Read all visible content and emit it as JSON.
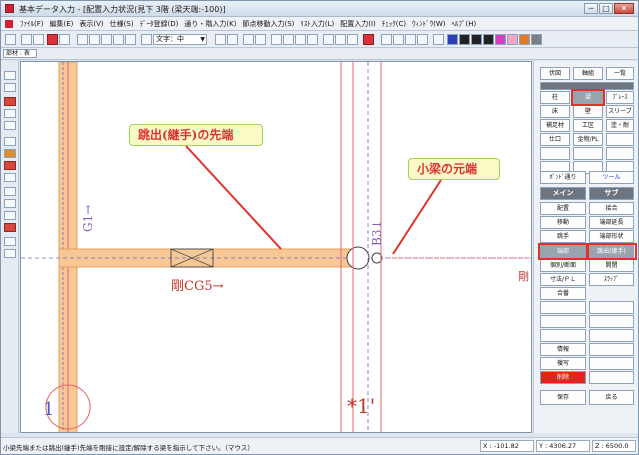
{
  "window": {
    "title": "基本データ入力 - [配置入力状況(見下 3階 (梁天端:-100)]",
    "controls": [
      "─",
      "□",
      "✕"
    ]
  },
  "menu": [
    "ﾌｧｲﾙ(F)",
    "編集(E)",
    "表示(V)",
    "仕様(S)",
    "ﾃﾞｰﾀ登録(D)",
    "通り・階入力(K)",
    "節点移動入力(S)",
    "ﾘｽﾄ入力(L)",
    "配置入力(I)",
    "ﾁｪｯｸ(C)",
    "ｳｨﾝﾄﾞｳ(W)",
    "ﾍﾙﾌﾟ(H)"
  ],
  "toolbar": {
    "font_combo": "文字：中",
    "colors": [
      "#2a3fb8",
      "#222222",
      "#222222",
      "#222222",
      "#d040c0",
      "#f2a6c8",
      "#e07b2a",
      "#7b7f86"
    ]
  },
  "subbar": {
    "field": "部材 : 表"
  },
  "canvas": {
    "callout_tip": "跳出(継手)の先端",
    "callout_base": "小梁の元端",
    "beam_label": "剛CG5→",
    "beam_label_right": "剛",
    "grid_g1": "G1→",
    "grid_b3": "B3↓",
    "grid_x1": "1",
    "grid_star": "*1'"
  },
  "panel": {
    "top_row": [
      "伏図",
      "軸組",
      "一覧"
    ],
    "grid": [
      [
        "柱",
        "梁",
        "ﾌﾞﾚｰｽ"
      ],
      [
        "床",
        "壁",
        "スリーブ"
      ],
      [
        "補足材",
        "工区",
        "塗・耐"
      ],
      [
        "仕口",
        "金物/PL",
        ""
      ]
    ],
    "misc": [
      "ﾎﾞﾝﾄﾞ通り",
      "ツール"
    ],
    "tabs": [
      "メイン",
      "サブ"
    ],
    "main_items": [
      "配置",
      "移動",
      "跳手",
      "端部",
      "個別/断面",
      "寸法/ＰＬ",
      "合番"
    ],
    "sub_items": [
      "接合",
      "端部延長",
      "端部形状",
      "跳出(継手)",
      "開閉",
      "ｽﾗｯﾌﾞ"
    ],
    "lower": [
      "情報",
      "複写",
      "削除"
    ],
    "footer": [
      "保存",
      "戻る"
    ]
  },
  "status": {
    "message": "小梁先端または跳出(継手)先端を剛接に設定/解除する梁を指示して下さい。（マウス）",
    "x": "X : -101.82",
    "y": "Y : 4306.27",
    "z": "Z : 6500.0"
  },
  "colors": {
    "beam_fill": "#f7c795",
    "beam_edge": "#e8a060",
    "grid_line": "#e06a6a",
    "dash_line": "#6f67c8",
    "highlight": "#e0322a"
  }
}
